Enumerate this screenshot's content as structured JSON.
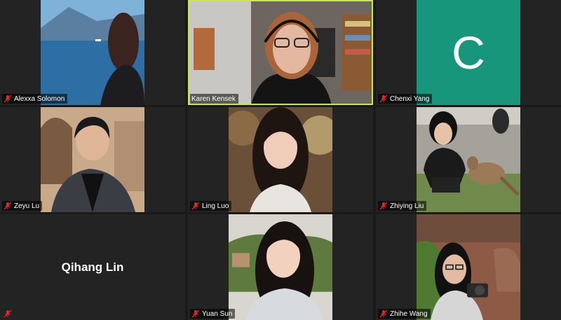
{
  "participants": [
    {
      "name": "Alexxa Solomon",
      "muted": true,
      "has_video": true,
      "speaking": false
    },
    {
      "name": "Karen Kensek",
      "muted": false,
      "has_video": true,
      "speaking": true
    },
    {
      "name": "Chenxi Yang",
      "muted": true,
      "has_video": false,
      "avatar_letter": "C",
      "avatar_color": "#18967b"
    },
    {
      "name": "Zeyu Lu",
      "muted": true,
      "has_video": true,
      "speaking": false
    },
    {
      "name": "Ling Luo",
      "muted": true,
      "has_video": true,
      "speaking": false
    },
    {
      "name": "Zhiying Liu",
      "muted": true,
      "has_video": true,
      "speaking": false
    },
    {
      "name": "Qihang Lin",
      "muted": true,
      "has_video": false,
      "speaking": false
    },
    {
      "name": "Yuan Sun",
      "muted": true,
      "has_video": true,
      "speaking": false
    },
    {
      "name": "Zhihe Wang",
      "muted": true,
      "has_video": true,
      "speaking": false
    }
  ],
  "colors": {
    "active_speaker_border": "#c6e84a",
    "muted_icon": "#e02828",
    "background": "#1a1a1a"
  }
}
